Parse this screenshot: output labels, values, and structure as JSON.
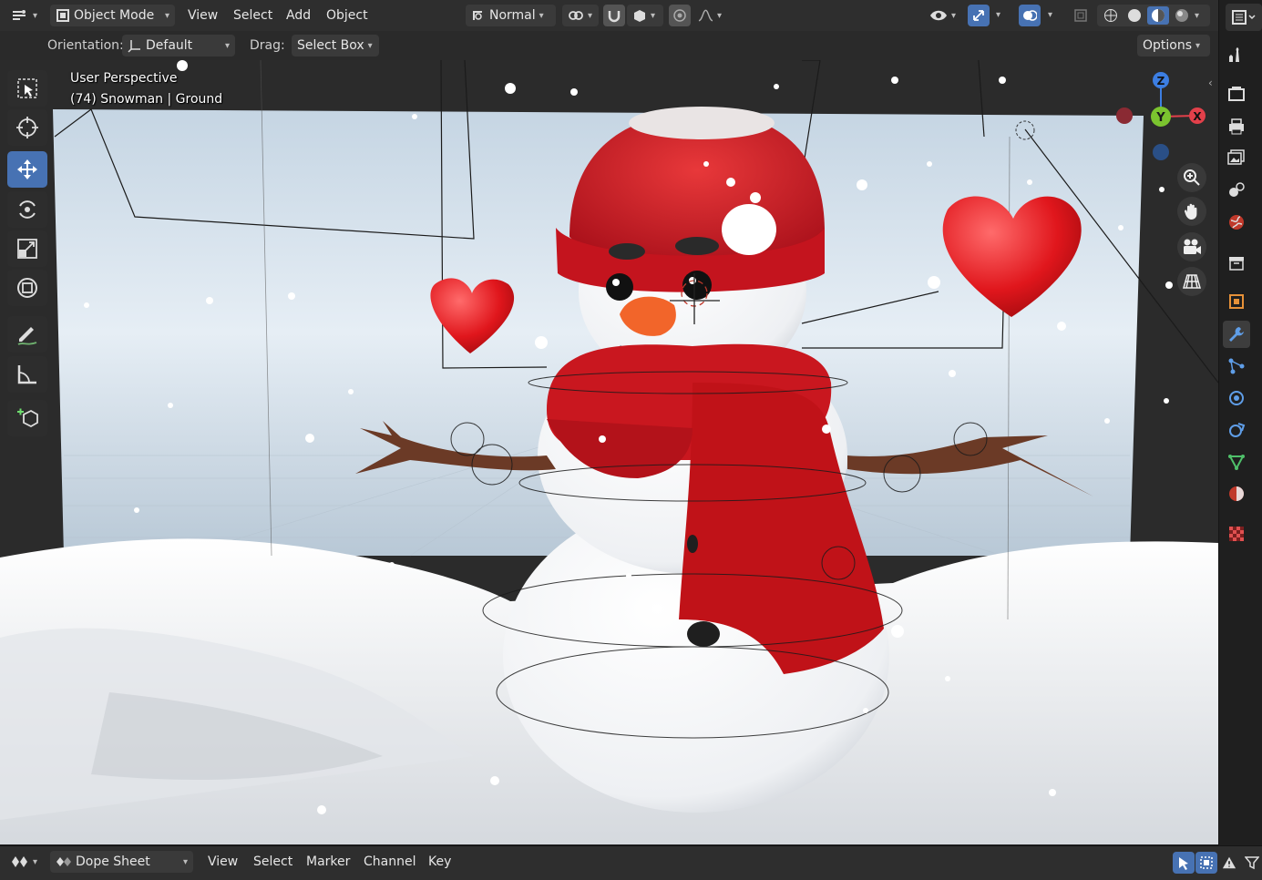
{
  "header": {
    "mode": "Object Mode",
    "menus": [
      "View",
      "Select",
      "Add",
      "Object"
    ],
    "transform_orientation": "Normal",
    "options_label": "Options"
  },
  "tool_settings": {
    "orientation_label": "Orientation:",
    "orientation_value": "Default",
    "drag_label": "Drag:",
    "drag_value": "Select Box"
  },
  "viewport": {
    "view_name": "User Perspective",
    "object_info": "(74) Snowman | Ground",
    "gizmo_axes": [
      "Z",
      "Y",
      "X"
    ]
  },
  "toolbar": {
    "tools": [
      "select-box",
      "cursor",
      "move",
      "rotate",
      "scale",
      "transform",
      "annotate",
      "measure",
      "add-cube"
    ],
    "active_tool": "move"
  },
  "properties_tabs": [
    "tool",
    "render",
    "output",
    "view-layer",
    "scene",
    "world",
    "collection",
    "object",
    "modifiers",
    "particles",
    "physics",
    "constraints",
    "data",
    "material",
    "texture"
  ],
  "active_properties_tab": "modifiers",
  "timeline": {
    "editor_type": "Dope Sheet",
    "menus": [
      "View",
      "Select",
      "Marker",
      "Channel",
      "Key"
    ]
  },
  "colors": {
    "accent": "#4772b3",
    "axis_x": "#e2404a",
    "axis_y": "#7bc42f",
    "axis_z": "#3c7ee2",
    "scarf_red": "#d21f25",
    "sky": "#cfdce8"
  }
}
